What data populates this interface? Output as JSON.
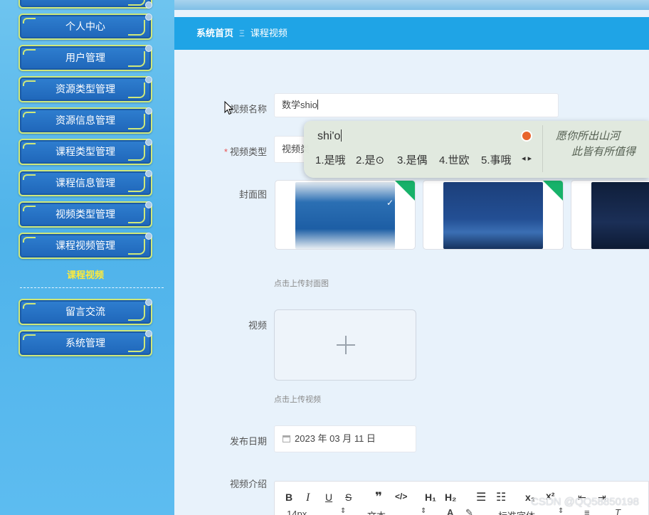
{
  "sidebar": {
    "menu_items": [
      {
        "label": "个人中心"
      },
      {
        "label": "用户管理"
      },
      {
        "label": "资源类型管理"
      },
      {
        "label": "资源信息管理"
      },
      {
        "label": "课程类型管理"
      },
      {
        "label": "课程信息管理"
      },
      {
        "label": "视频类型管理"
      },
      {
        "label": "课程视频管理"
      }
    ],
    "submenu_label": "课程视频",
    "bottom_items": [
      {
        "label": "留言交流"
      },
      {
        "label": "系统管理"
      }
    ]
  },
  "breadcrumb": {
    "home": "系统首页",
    "separator": "Ξ",
    "current": "课程视频"
  },
  "form": {
    "video_name": {
      "label": "视频名称",
      "required_mark": "*",
      "value": "数学shio"
    },
    "video_type": {
      "label": "视频类型",
      "required_mark": "*",
      "value": "视频类"
    },
    "cover": {
      "label": "封面图",
      "hint": "点击上传封面图"
    },
    "video": {
      "label": "视频",
      "hint": "点击上传视频"
    },
    "publish_date": {
      "label": "发布日期",
      "value": "2023 年 03 月 11 日"
    },
    "intro": {
      "label": "视频介绍"
    }
  },
  "editor_toolbar": {
    "buttons": [
      "B",
      "I",
      "U",
      "S",
      "❞",
      "</>",
      "H₁",
      "H₂",
      "☰",
      "☷",
      "x₂",
      "x²"
    ],
    "font_size": "14px",
    "text_style": "文本",
    "font_family": "标准字体"
  },
  "ime": {
    "composition": "shi'o",
    "candidates": [
      "1.是哦",
      "2.是⊙",
      "3.是偶",
      "4.世欧",
      "5.事哦"
    ],
    "ad_text_line1": "愿你所出山河",
    "ad_text_line2": "此皆有所值得"
  },
  "watermark": "CSDN @QQ58850198",
  "colors": {
    "breadcrumb_bg": "#1fa4e6",
    "sidebar_bg": "#5dbcf0",
    "menu_button_bg": "#2570c6",
    "menu_button_border": "#cfe87a",
    "submenu_active": "#ffea3a",
    "required": "#e85454"
  }
}
